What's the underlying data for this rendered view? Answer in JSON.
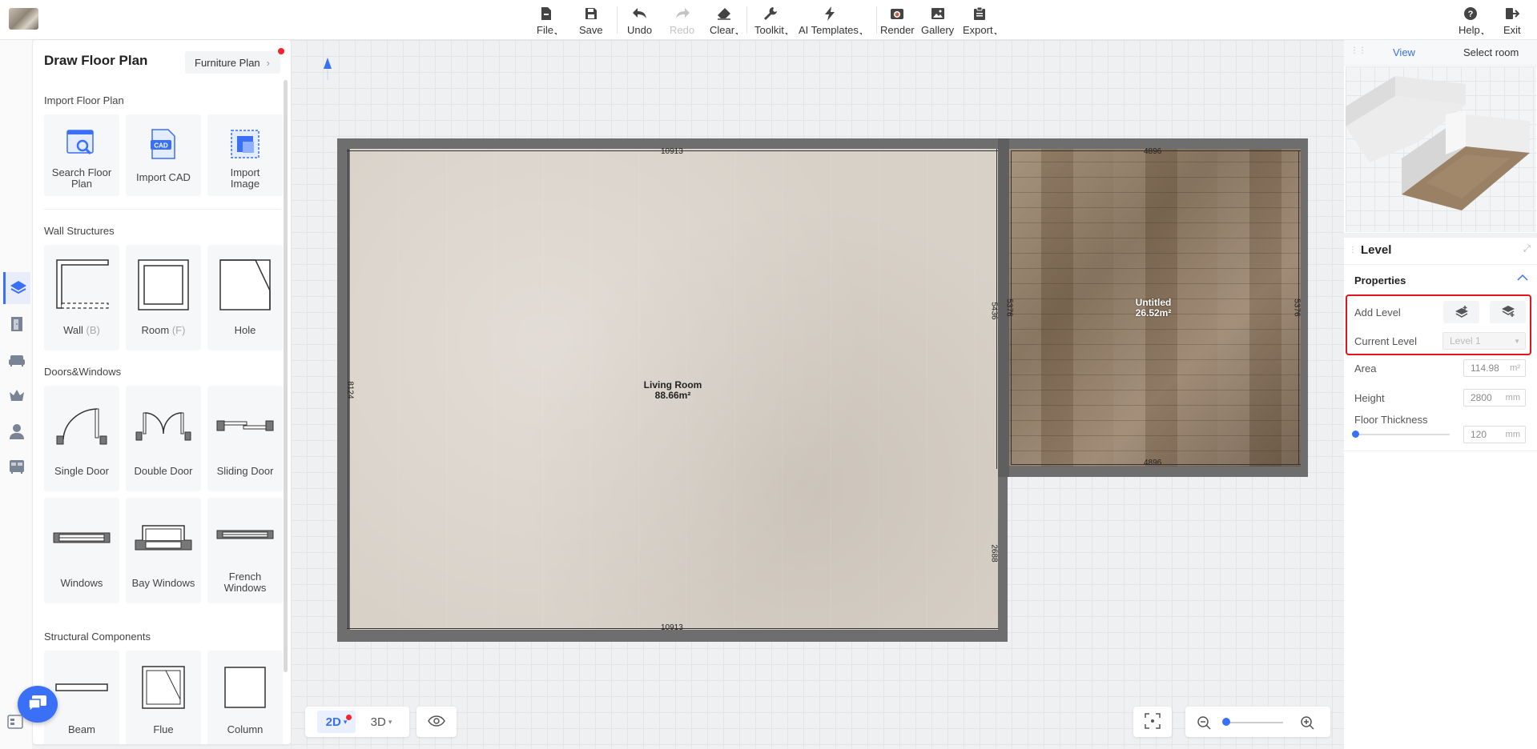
{
  "toolbar": {
    "items": [
      {
        "label": "File",
        "icon": "file-icon",
        "caret": true
      },
      {
        "label": "Save",
        "icon": "save-icon",
        "caret": false
      },
      {
        "label": "Undo",
        "icon": "undo-icon",
        "caret": false
      },
      {
        "label": "Redo",
        "icon": "redo-icon",
        "caret": false,
        "disabled": true
      },
      {
        "label": "Clear",
        "icon": "eraser-icon",
        "caret": true
      },
      {
        "label": "Toolkit",
        "icon": "wrench-icon",
        "caret": true
      },
      {
        "label": "AI Templates",
        "icon": "lightning-icon",
        "caret": true
      },
      {
        "label": "Render",
        "icon": "camera-icon",
        "caret": false
      },
      {
        "label": "Gallery",
        "icon": "image-icon",
        "caret": false
      },
      {
        "label": "Export",
        "icon": "clipboard-icon",
        "caret": true
      }
    ],
    "help_label": "Help",
    "exit_label": "Exit"
  },
  "left_panel": {
    "title": "Draw Floor Plan",
    "furniture_plan_label": "Furniture Plan",
    "sections": {
      "import": {
        "title": "Import Floor Plan",
        "tiles": [
          "Search Floor Plan",
          "Import CAD",
          "Import Image"
        ],
        "cad_badge": "CAD"
      },
      "walls": {
        "title": "Wall Structures",
        "tiles": [
          {
            "label": "Wall",
            "shortcut": "(B)"
          },
          {
            "label": "Room",
            "shortcut": "(F)"
          },
          {
            "label": "Hole",
            "shortcut": ""
          }
        ]
      },
      "doors": {
        "title": "Doors&Windows",
        "tiles": [
          "Single Door",
          "Double Door",
          "Sliding Door",
          "Windows",
          "Bay Windows",
          "French Windows"
        ]
      },
      "structural": {
        "title": "Structural Components",
        "tiles": [
          "Beam",
          "Flue",
          "Column"
        ]
      }
    }
  },
  "canvas": {
    "rooms": [
      {
        "name": "Living Room",
        "area": "88.66m²"
      },
      {
        "name": "Untitled",
        "area": "26.52m²"
      }
    ],
    "dimensions": {
      "living_top": "10913",
      "living_bottom": "10913",
      "living_left": "8124",
      "living_right_upper": "5436",
      "living_right_lower": "2688",
      "untitled_top": "4896",
      "untitled_bottom": "4896",
      "untitled_left": "5376",
      "untitled_right": "5376"
    },
    "view_modes": {
      "mode_2d": "2D",
      "mode_3d": "3D"
    }
  },
  "right_panel": {
    "tabs": [
      "View",
      "Select room"
    ],
    "level_title": "Level",
    "properties_title": "Properties",
    "add_level_label": "Add Level",
    "current_level_label": "Current Level",
    "current_level_value": "Level 1",
    "area_label": "Area",
    "area_value": "114.98",
    "area_unit": "m²",
    "height_label": "Height",
    "height_value": "2800",
    "height_unit": "mm",
    "floor_thickness_label": "Floor Thickness",
    "floor_thickness_value": "120",
    "floor_thickness_unit": "mm"
  },
  "colors": {
    "accent": "#3a6ff7",
    "highlight_border": "#e3141c",
    "notification_dot": "#f5222d"
  }
}
